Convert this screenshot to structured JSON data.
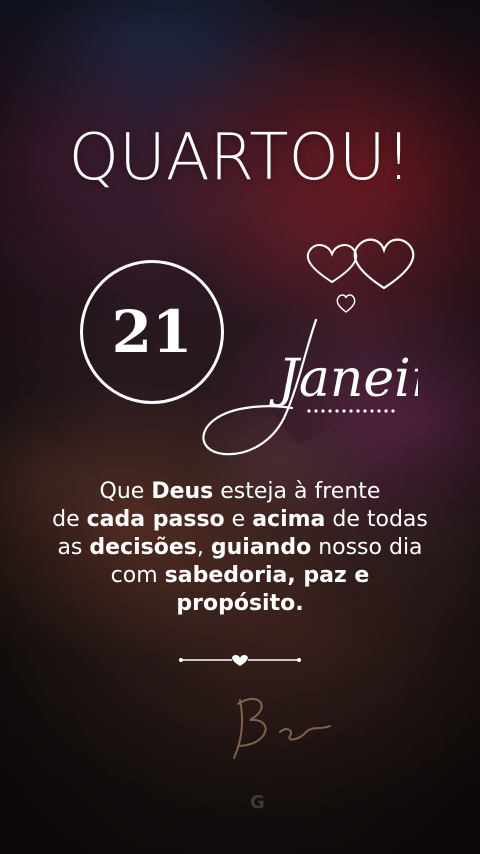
{
  "header": {
    "title": "QUARTOU!"
  },
  "date": {
    "day": "21",
    "month": "Janeiro"
  },
  "message": {
    "parts": [
      {
        "text": "Que ",
        "bold": false
      },
      {
        "text": "Deus",
        "bold": true
      },
      {
        "text": " esteja à frente",
        "bold": false
      },
      {
        "br": true
      },
      {
        "text": "de ",
        "bold": false
      },
      {
        "text": "cada passo",
        "bold": true
      },
      {
        "text": " e ",
        "bold": false
      },
      {
        "text": "acima",
        "bold": true
      },
      {
        "text": " de todas",
        "bold": false
      },
      {
        "br": true
      },
      {
        "text": "as ",
        "bold": false
      },
      {
        "text": "decisões",
        "bold": true
      },
      {
        "text": ", ",
        "bold": false
      },
      {
        "text": "guiando",
        "bold": true
      },
      {
        "text": " nosso dia",
        "bold": false
      },
      {
        "br": true
      },
      {
        "text": "com ",
        "bold": false
      },
      {
        "text": "sabedoria, paz e",
        "bold": true
      },
      {
        "br": true
      },
      {
        "text": "propósito.",
        "bold": true
      }
    ]
  },
  "colors": {
    "text": "#ffffff",
    "accent_red": "#c42a34"
  },
  "icons": [
    "heart-icon",
    "heart-divider-icon"
  ]
}
